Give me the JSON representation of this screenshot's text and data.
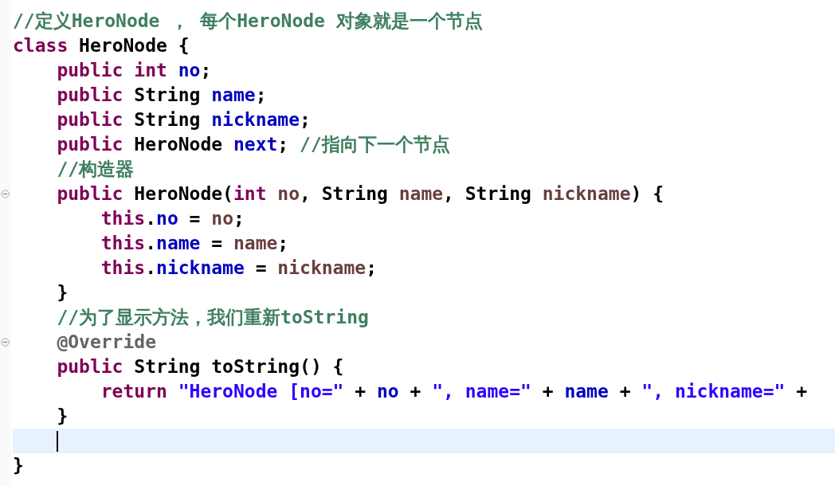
{
  "editor": {
    "lines": [
      {
        "foldable": false,
        "current": false,
        "tokens": [
          {
            "kind": "comment",
            "text": "//定义HeroNode ， 每个HeroNode 对象就是一个节点"
          }
        ]
      },
      {
        "foldable": false,
        "current": false,
        "tokens": [
          {
            "kind": "keyword",
            "text": "class"
          },
          {
            "kind": "plain",
            "text": " HeroNode {"
          }
        ]
      },
      {
        "foldable": false,
        "current": false,
        "tokens": [
          {
            "kind": "keyword",
            "text": "    public int"
          },
          {
            "kind": "field",
            "text": " no"
          },
          {
            "kind": "plain",
            "text": ";"
          }
        ]
      },
      {
        "foldable": false,
        "current": false,
        "tokens": [
          {
            "kind": "keyword",
            "text": "    public"
          },
          {
            "kind": "plain",
            "text": " String "
          },
          {
            "kind": "field",
            "text": "name"
          },
          {
            "kind": "plain",
            "text": ";"
          }
        ]
      },
      {
        "foldable": false,
        "current": false,
        "tokens": [
          {
            "kind": "keyword",
            "text": "    public"
          },
          {
            "kind": "plain",
            "text": " String "
          },
          {
            "kind": "field",
            "text": "nickname"
          },
          {
            "kind": "plain",
            "text": ";"
          }
        ]
      },
      {
        "foldable": false,
        "current": false,
        "tokens": [
          {
            "kind": "keyword",
            "text": "    public"
          },
          {
            "kind": "plain",
            "text": " HeroNode "
          },
          {
            "kind": "field",
            "text": "next"
          },
          {
            "kind": "plain",
            "text": "; "
          },
          {
            "kind": "comment",
            "text": "//指向下一个节点"
          }
        ]
      },
      {
        "foldable": false,
        "current": false,
        "tokens": [
          {
            "kind": "comment",
            "text": "    //构造器"
          }
        ]
      },
      {
        "foldable": true,
        "current": false,
        "tokens": [
          {
            "kind": "keyword",
            "text": "    public"
          },
          {
            "kind": "plain",
            "text": " HeroNode("
          },
          {
            "kind": "keyword",
            "text": "int"
          },
          {
            "kind": "local",
            "text": " no"
          },
          {
            "kind": "plain",
            "text": ", String "
          },
          {
            "kind": "local",
            "text": "name"
          },
          {
            "kind": "plain",
            "text": ", String "
          },
          {
            "kind": "local",
            "text": "nickname"
          },
          {
            "kind": "plain",
            "text": ") {"
          }
        ]
      },
      {
        "foldable": false,
        "current": false,
        "tokens": [
          {
            "kind": "keyword",
            "text": "        this"
          },
          {
            "kind": "plain",
            "text": "."
          },
          {
            "kind": "field",
            "text": "no"
          },
          {
            "kind": "plain",
            "text": " = "
          },
          {
            "kind": "local",
            "text": "no"
          },
          {
            "kind": "plain",
            "text": ";"
          }
        ]
      },
      {
        "foldable": false,
        "current": false,
        "tokens": [
          {
            "kind": "keyword",
            "text": "        this"
          },
          {
            "kind": "plain",
            "text": "."
          },
          {
            "kind": "field",
            "text": "name"
          },
          {
            "kind": "plain",
            "text": " = "
          },
          {
            "kind": "local",
            "text": "name"
          },
          {
            "kind": "plain",
            "text": ";"
          }
        ]
      },
      {
        "foldable": false,
        "current": false,
        "tokens": [
          {
            "kind": "keyword",
            "text": "        this"
          },
          {
            "kind": "plain",
            "text": "."
          },
          {
            "kind": "field",
            "text": "nickname"
          },
          {
            "kind": "plain",
            "text": " = "
          },
          {
            "kind": "local",
            "text": "nickname"
          },
          {
            "kind": "plain",
            "text": ";"
          }
        ]
      },
      {
        "foldable": false,
        "current": false,
        "tokens": [
          {
            "kind": "plain",
            "text": "    }"
          }
        ]
      },
      {
        "foldable": false,
        "current": false,
        "tokens": [
          {
            "kind": "comment",
            "text": "    //为了显示方法，我们重新toString"
          }
        ]
      },
      {
        "foldable": true,
        "current": false,
        "tokens": [
          {
            "kind": "annotation",
            "text": "    @Override"
          }
        ]
      },
      {
        "foldable": false,
        "current": false,
        "tokens": [
          {
            "kind": "keyword",
            "text": "    public"
          },
          {
            "kind": "plain",
            "text": " String toString() {"
          }
        ]
      },
      {
        "foldable": false,
        "current": false,
        "tokens": [
          {
            "kind": "keyword",
            "text": "        return"
          },
          {
            "kind": "string",
            "text": " \"HeroNode [no=\""
          },
          {
            "kind": "plain",
            "text": " + "
          },
          {
            "kind": "field",
            "text": "no"
          },
          {
            "kind": "plain",
            "text": " + "
          },
          {
            "kind": "string",
            "text": "\", name=\""
          },
          {
            "kind": "plain",
            "text": " + "
          },
          {
            "kind": "field",
            "text": "name"
          },
          {
            "kind": "plain",
            "text": " + "
          },
          {
            "kind": "string",
            "text": "\", nickname=\""
          },
          {
            "kind": "plain",
            "text": " +"
          }
        ]
      },
      {
        "foldable": false,
        "current": false,
        "tokens": [
          {
            "kind": "plain",
            "text": "    }"
          }
        ]
      },
      {
        "foldable": false,
        "current": true
      },
      {
        "foldable": false,
        "current": false,
        "tokens": [
          {
            "kind": "plain",
            "text": "}"
          }
        ]
      }
    ]
  }
}
